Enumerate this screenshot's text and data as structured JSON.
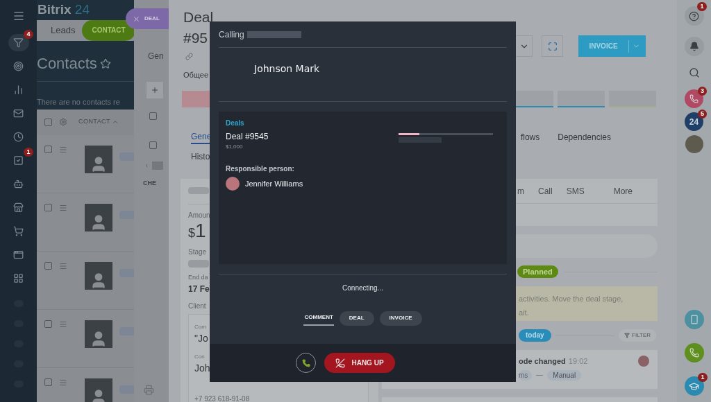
{
  "nav": {
    "items": [
      {
        "selected": true,
        "badge": "4"
      },
      {
        "selected": false
      },
      {
        "selected": false
      },
      {
        "selected": false
      },
      {
        "selected": false
      },
      {
        "selected": false,
        "badge": "1"
      },
      {
        "selected": false
      },
      {
        "selected": false
      },
      {
        "selected": false
      },
      {
        "selected": false
      },
      {
        "selected": false
      }
    ]
  },
  "crm": {
    "logo": {
      "text": "Bitrix",
      "number": "24"
    },
    "tabs": [
      {
        "label": "Leads",
        "selected": false
      },
      {
        "label": "CONTACT",
        "selected": true
      }
    ],
    "title": "Contacts",
    "empty_note": "There are no contacts re",
    "table": {
      "header": {
        "checked": false,
        "column": "CONTACT"
      },
      "rows": [
        {
          "checked": false
        },
        {
          "checked": false
        },
        {
          "checked": false
        },
        {
          "checked": false
        },
        {
          "checked": false
        }
      ]
    }
  },
  "slider": {
    "tab": "DEAL",
    "section": "Gen",
    "rows": [
      {
        "checked": false
      },
      {
        "checked": false
      }
    ],
    "column": "CHE"
  },
  "deal": {
    "title": "Deal #95",
    "subtitle": "Общее",
    "buttons": {
      "invoice": "INVOICE"
    },
    "tabs": [
      {
        "label": "Gene",
        "selected": true
      },
      {
        "label": "Histo",
        "selected": false
      }
    ],
    "tabs_right": [
      {
        "label": "flows",
        "selected": false
      },
      {
        "label": "Dependencies",
        "selected": false
      }
    ],
    "fields": {
      "amount_label": "Amoun",
      "currency": "$",
      "amount": "1",
      "stage_label": "Stage",
      "end_label": "End da",
      "end_value": "17 Fe",
      "client_label": "Client",
      "company_label": "Com",
      "company": "\"Jo",
      "contact_label": "Con",
      "contact": "Joh",
      "phone": "+7 923 618-91-08"
    },
    "activity_tabs": [
      {
        "label": "m"
      },
      {
        "label": "Call"
      },
      {
        "label": "SMS"
      },
      {
        "label": "More"
      }
    ],
    "planned": "Planned",
    "note": [
      "activities. Move the deal stage,",
      "ait."
    ],
    "today": "today",
    "filter": "FILTER",
    "history": {
      "title": "ode changed",
      "time": "19:02",
      "from": "ms",
      "to": "Manual"
    }
  },
  "call_dialog": {
    "title": "Calling",
    "contact_name": "Johnson Mark",
    "deals_heading": "Deals",
    "deal": {
      "name": "Deal #9545",
      "amount": "$1,000",
      "level": 0.22
    },
    "responsible_label": "Responsible person:",
    "responsible_name": "Jennifer Williams",
    "status": "Connecting...",
    "tabs": [
      {
        "label": "COMMENT",
        "selected": true
      },
      {
        "label": "DEAL",
        "selected": false
      },
      {
        "label": "INVOICE",
        "selected": false
      }
    ],
    "hang_up": "HANG UP"
  },
  "right_bar": {
    "help_badge": "1",
    "calls_badge": "3",
    "b24": {
      "label": "24",
      "badge": "5"
    },
    "learning_badge": "1"
  }
}
